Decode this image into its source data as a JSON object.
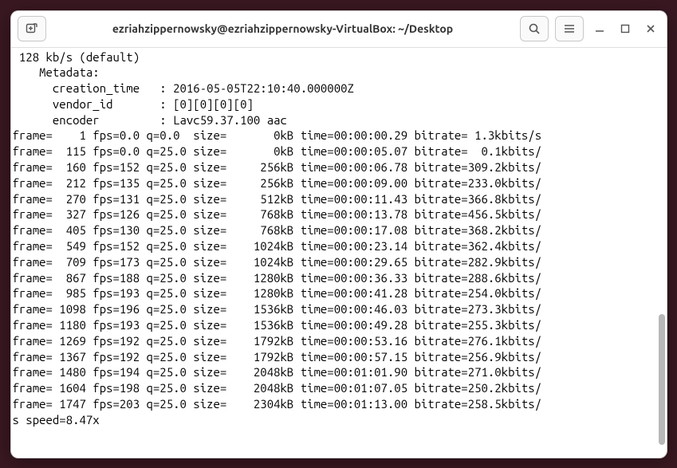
{
  "window": {
    "title": "ezriahzippernowsky@ezriahzippernowsky-VirtualBox: ~/Desktop"
  },
  "terminal": {
    "header_lines": [
      " 128 kb/s (default)",
      "    Metadata:",
      "      creation_time   : 2016-05-05T22:10:40.000000Z",
      "      vendor_id       : [0][0][0][0]",
      "      encoder         : Lavc59.37.100 aac"
    ],
    "frames": [
      {
        "frame": 1,
        "fps": "0.0",
        "q": "0.0",
        "size": "0kB",
        "time": "00:00:00.29",
        "bitrate": "1.3kbits/s"
      },
      {
        "frame": 115,
        "fps": "0.0",
        "q": "25.0",
        "size": "0kB",
        "time": "00:00:05.07",
        "bitrate": "0.1kbits/"
      },
      {
        "frame": 160,
        "fps": "152",
        "q": "25.0",
        "size": "256kB",
        "time": "00:00:06.78",
        "bitrate": "309.2kbits/"
      },
      {
        "frame": 212,
        "fps": "135",
        "q": "25.0",
        "size": "256kB",
        "time": "00:00:09.00",
        "bitrate": "233.0kbits/"
      },
      {
        "frame": 270,
        "fps": "131",
        "q": "25.0",
        "size": "512kB",
        "time": "00:00:11.43",
        "bitrate": "366.8kbits/"
      },
      {
        "frame": 327,
        "fps": "126",
        "q": "25.0",
        "size": "768kB",
        "time": "00:00:13.78",
        "bitrate": "456.5kbits/"
      },
      {
        "frame": 405,
        "fps": "130",
        "q": "25.0",
        "size": "768kB",
        "time": "00:00:17.08",
        "bitrate": "368.2kbits/"
      },
      {
        "frame": 549,
        "fps": "152",
        "q": "25.0",
        "size": "1024kB",
        "time": "00:00:23.14",
        "bitrate": "362.4kbits/"
      },
      {
        "frame": 709,
        "fps": "173",
        "q": "25.0",
        "size": "1024kB",
        "time": "00:00:29.65",
        "bitrate": "282.9kbits/"
      },
      {
        "frame": 867,
        "fps": "188",
        "q": "25.0",
        "size": "1280kB",
        "time": "00:00:36.33",
        "bitrate": "288.6kbits/"
      },
      {
        "frame": 985,
        "fps": "193",
        "q": "25.0",
        "size": "1280kB",
        "time": "00:00:41.28",
        "bitrate": "254.0kbits/"
      },
      {
        "frame": 1098,
        "fps": "196",
        "q": "25.0",
        "size": "1536kB",
        "time": "00:00:46.03",
        "bitrate": "273.3kbits/"
      },
      {
        "frame": 1180,
        "fps": "193",
        "q": "25.0",
        "size": "1536kB",
        "time": "00:00:49.28",
        "bitrate": "255.3kbits/"
      },
      {
        "frame": 1269,
        "fps": "192",
        "q": "25.0",
        "size": "1792kB",
        "time": "00:00:53.16",
        "bitrate": "276.1kbits/"
      },
      {
        "frame": 1367,
        "fps": "192",
        "q": "25.0",
        "size": "1792kB",
        "time": "00:00:57.15",
        "bitrate": "256.9kbits/"
      },
      {
        "frame": 1480,
        "fps": "194",
        "q": "25.0",
        "size": "2048kB",
        "time": "00:01:01.90",
        "bitrate": "271.0kbits/"
      },
      {
        "frame": 1604,
        "fps": "198",
        "q": "25.0",
        "size": "2048kB",
        "time": "00:01:07.05",
        "bitrate": "250.2kbits/"
      },
      {
        "frame": 1747,
        "fps": "203",
        "q": "25.0",
        "size": "2304kB",
        "time": "00:01:13.00",
        "bitrate": "258.5kbits/"
      }
    ],
    "footer_line": "s speed=8.47x"
  }
}
